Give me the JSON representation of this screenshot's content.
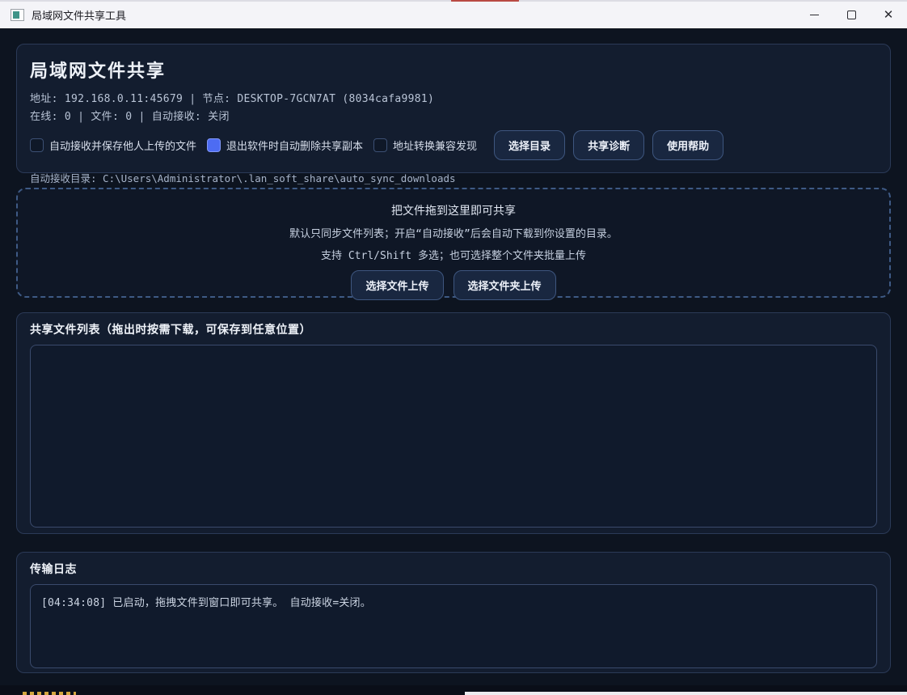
{
  "titlebar": {
    "title": "局域网文件共享工具"
  },
  "header": {
    "title": "局域网文件共享",
    "address_line": "地址: 192.168.0.11:45679  |  节点: DESKTOP-7GCN7AT (8034cafa9981)",
    "status_line": "在线: 0  |  文件: 0  |  自动接收: 关闭",
    "checkboxes": [
      {
        "label": "自动接收并保存他人上传的文件",
        "checked": false
      },
      {
        "label": "退出软件时自动删除共享副本",
        "checked": true
      },
      {
        "label": "地址转换兼容发现",
        "checked": false
      }
    ],
    "buttons": [
      {
        "label": "选择目录"
      },
      {
        "label": "共享诊断"
      },
      {
        "label": "使用帮助"
      }
    ],
    "auto_receive_dir": "自动接收目录: C:\\Users\\Administrator\\.lan_soft_share\\auto_sync_downloads"
  },
  "dropzone": {
    "line1": "把文件拖到这里即可共享",
    "line2": "默认只同步文件列表；开启“自动接收”后会自动下载到你设置的目录。",
    "line3": "支持 Ctrl/Shift 多选；也可选择整个文件夹批量上传",
    "buttons": [
      {
        "label": "选择文件上传"
      },
      {
        "label": "选择文件夹上传"
      }
    ]
  },
  "file_list": {
    "title": "共享文件列表（拖出时按需下载，可保存到任意位置）",
    "items": []
  },
  "log": {
    "title": "传输日志",
    "entries": [
      "[04:34:08] 已启动，拖拽文件到窗口即可共享。 自动接收=关闭。"
    ]
  },
  "colors": {
    "accent_checkbox": "#4d6cf3",
    "panel_bg": "#131d2f",
    "panel_border": "#2b3a57",
    "window_bg": "#0d1420",
    "titlebar_bg": "#f4f4f8"
  }
}
